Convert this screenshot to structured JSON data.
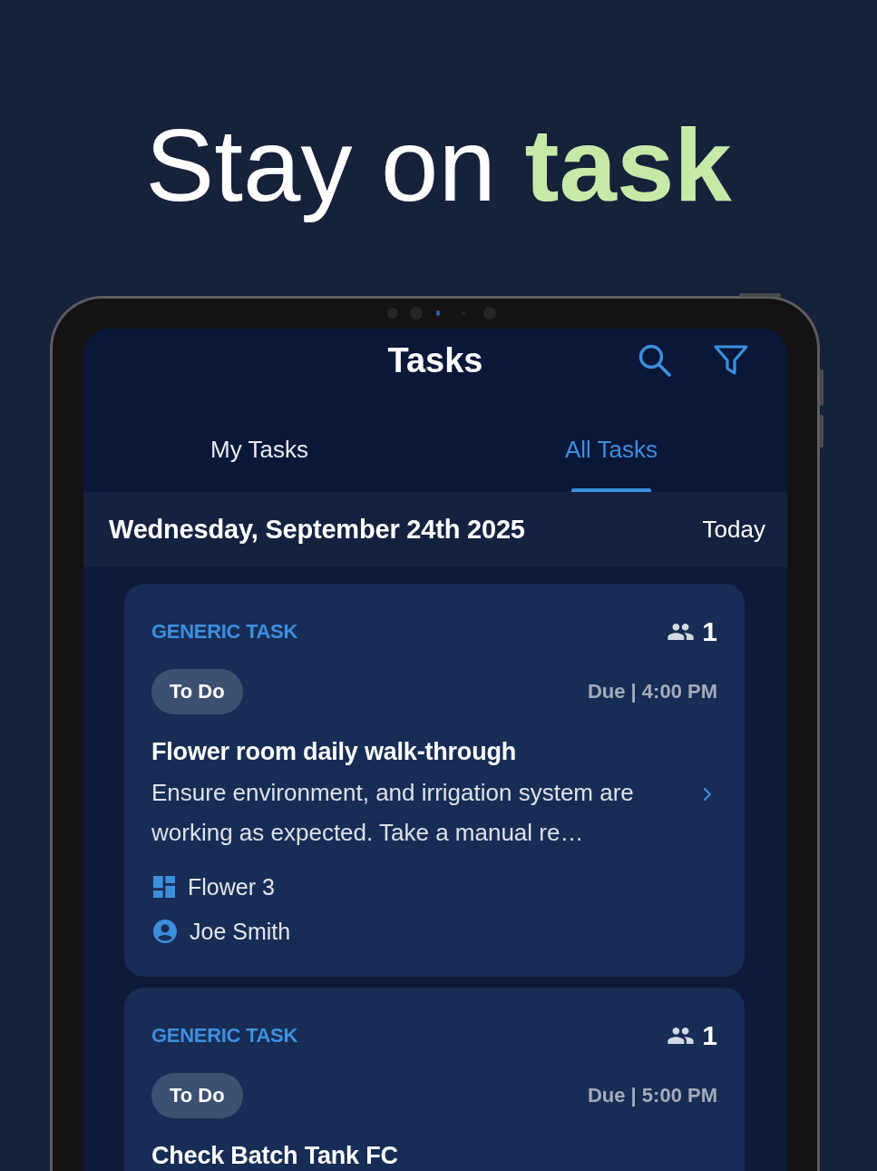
{
  "headline": "Stay on **task**",
  "header": {
    "title": "Tasks"
  },
  "tabs": [
    {
      "label": "My Tasks",
      "selected": false
    },
    {
      "label": "All Tasks",
      "selected": true
    }
  ],
  "date_bar": {
    "date": "Wednesday, September 24th 2025",
    "today_button": "Today"
  },
  "tasks": [
    {
      "type_label": "GENERIC TASK",
      "assignee_count": "1",
      "status": "To Do",
      "due": "Due | 4:00 PM",
      "title": "Flower room daily walk-through",
      "description": "Ensure environment, and irrigation system are working as expected. Take a manual re…",
      "location": "Flower 3",
      "assignee": "Joe Smith"
    },
    {
      "type_label": "GENERIC TASK",
      "assignee_count": "1",
      "status": "To Do",
      "due": "Due | 5:00 PM",
      "title": "Check Batch Tank FC"
    }
  ]
}
